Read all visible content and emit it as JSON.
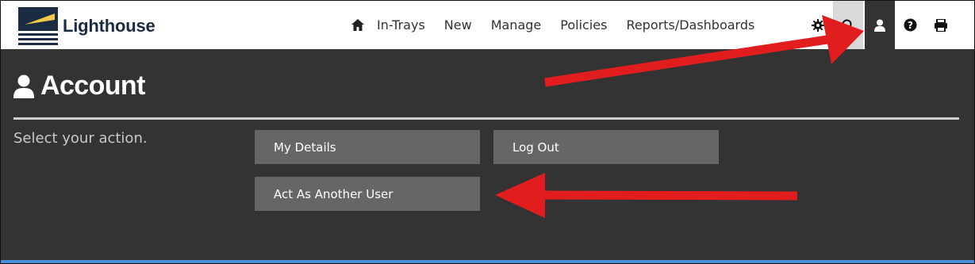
{
  "brand": {
    "name": "Lighthouse"
  },
  "nav": {
    "home_icon": "home-icon",
    "links": [
      "In-Trays",
      "New",
      "Manage",
      "Policies",
      "Reports/Dashboards"
    ],
    "icons": [
      "gear-icon",
      "search-icon",
      "user-icon",
      "help-icon",
      "print-icon"
    ]
  },
  "page": {
    "title": "Account",
    "prompt": "Select your action."
  },
  "actions": {
    "my_details": "My Details",
    "log_out": "Log Out",
    "act_as": "Act As Another User"
  },
  "colors": {
    "background": "#333333",
    "navbar": "#ffffff",
    "button": "#666666",
    "arrow": "#e11d1d",
    "accent_strip": "#4a90d9"
  }
}
